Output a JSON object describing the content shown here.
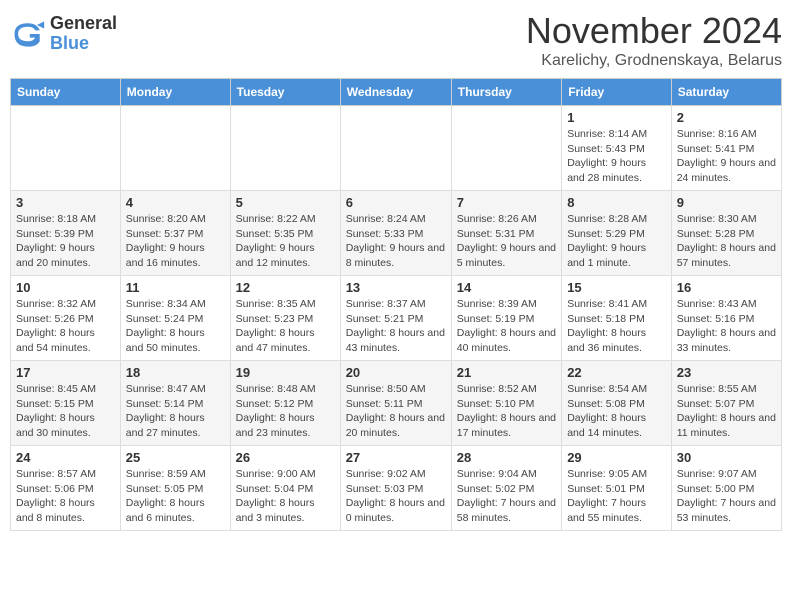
{
  "logo": {
    "general": "General",
    "blue": "Blue"
  },
  "title": {
    "month": "November 2024",
    "location": "Karelichy, Grodnenskaya, Belarus"
  },
  "headers": [
    "Sunday",
    "Monday",
    "Tuesday",
    "Wednesday",
    "Thursday",
    "Friday",
    "Saturday"
  ],
  "weeks": [
    [
      {
        "day": "",
        "info": ""
      },
      {
        "day": "",
        "info": ""
      },
      {
        "day": "",
        "info": ""
      },
      {
        "day": "",
        "info": ""
      },
      {
        "day": "",
        "info": ""
      },
      {
        "day": "1",
        "info": "Sunrise: 8:14 AM\nSunset: 5:43 PM\nDaylight: 9 hours and 28 minutes."
      },
      {
        "day": "2",
        "info": "Sunrise: 8:16 AM\nSunset: 5:41 PM\nDaylight: 9 hours and 24 minutes."
      }
    ],
    [
      {
        "day": "3",
        "info": "Sunrise: 8:18 AM\nSunset: 5:39 PM\nDaylight: 9 hours and 20 minutes."
      },
      {
        "day": "4",
        "info": "Sunrise: 8:20 AM\nSunset: 5:37 PM\nDaylight: 9 hours and 16 minutes."
      },
      {
        "day": "5",
        "info": "Sunrise: 8:22 AM\nSunset: 5:35 PM\nDaylight: 9 hours and 12 minutes."
      },
      {
        "day": "6",
        "info": "Sunrise: 8:24 AM\nSunset: 5:33 PM\nDaylight: 9 hours and 8 minutes."
      },
      {
        "day": "7",
        "info": "Sunrise: 8:26 AM\nSunset: 5:31 PM\nDaylight: 9 hours and 5 minutes."
      },
      {
        "day": "8",
        "info": "Sunrise: 8:28 AM\nSunset: 5:29 PM\nDaylight: 9 hours and 1 minute."
      },
      {
        "day": "9",
        "info": "Sunrise: 8:30 AM\nSunset: 5:28 PM\nDaylight: 8 hours and 57 minutes."
      }
    ],
    [
      {
        "day": "10",
        "info": "Sunrise: 8:32 AM\nSunset: 5:26 PM\nDaylight: 8 hours and 54 minutes."
      },
      {
        "day": "11",
        "info": "Sunrise: 8:34 AM\nSunset: 5:24 PM\nDaylight: 8 hours and 50 minutes."
      },
      {
        "day": "12",
        "info": "Sunrise: 8:35 AM\nSunset: 5:23 PM\nDaylight: 8 hours and 47 minutes."
      },
      {
        "day": "13",
        "info": "Sunrise: 8:37 AM\nSunset: 5:21 PM\nDaylight: 8 hours and 43 minutes."
      },
      {
        "day": "14",
        "info": "Sunrise: 8:39 AM\nSunset: 5:19 PM\nDaylight: 8 hours and 40 minutes."
      },
      {
        "day": "15",
        "info": "Sunrise: 8:41 AM\nSunset: 5:18 PM\nDaylight: 8 hours and 36 minutes."
      },
      {
        "day": "16",
        "info": "Sunrise: 8:43 AM\nSunset: 5:16 PM\nDaylight: 8 hours and 33 minutes."
      }
    ],
    [
      {
        "day": "17",
        "info": "Sunrise: 8:45 AM\nSunset: 5:15 PM\nDaylight: 8 hours and 30 minutes."
      },
      {
        "day": "18",
        "info": "Sunrise: 8:47 AM\nSunset: 5:14 PM\nDaylight: 8 hours and 27 minutes."
      },
      {
        "day": "19",
        "info": "Sunrise: 8:48 AM\nSunset: 5:12 PM\nDaylight: 8 hours and 23 minutes."
      },
      {
        "day": "20",
        "info": "Sunrise: 8:50 AM\nSunset: 5:11 PM\nDaylight: 8 hours and 20 minutes."
      },
      {
        "day": "21",
        "info": "Sunrise: 8:52 AM\nSunset: 5:10 PM\nDaylight: 8 hours and 17 minutes."
      },
      {
        "day": "22",
        "info": "Sunrise: 8:54 AM\nSunset: 5:08 PM\nDaylight: 8 hours and 14 minutes."
      },
      {
        "day": "23",
        "info": "Sunrise: 8:55 AM\nSunset: 5:07 PM\nDaylight: 8 hours and 11 minutes."
      }
    ],
    [
      {
        "day": "24",
        "info": "Sunrise: 8:57 AM\nSunset: 5:06 PM\nDaylight: 8 hours and 8 minutes."
      },
      {
        "day": "25",
        "info": "Sunrise: 8:59 AM\nSunset: 5:05 PM\nDaylight: 8 hours and 6 minutes."
      },
      {
        "day": "26",
        "info": "Sunrise: 9:00 AM\nSunset: 5:04 PM\nDaylight: 8 hours and 3 minutes."
      },
      {
        "day": "27",
        "info": "Sunrise: 9:02 AM\nSunset: 5:03 PM\nDaylight: 8 hours and 0 minutes."
      },
      {
        "day": "28",
        "info": "Sunrise: 9:04 AM\nSunset: 5:02 PM\nDaylight: 7 hours and 58 minutes."
      },
      {
        "day": "29",
        "info": "Sunrise: 9:05 AM\nSunset: 5:01 PM\nDaylight: 7 hours and 55 minutes."
      },
      {
        "day": "30",
        "info": "Sunrise: 9:07 AM\nSunset: 5:00 PM\nDaylight: 7 hours and 53 minutes."
      }
    ]
  ]
}
